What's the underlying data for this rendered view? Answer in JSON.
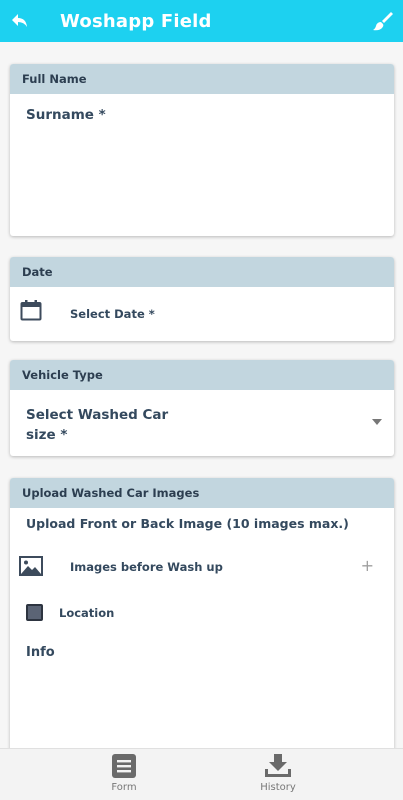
{
  "appbar": {
    "title": "Woshapp Field",
    "back_icon": "back-arrow-icon",
    "action_icon": "paint-brush-icon",
    "color": "#1dd1f0"
  },
  "full_name": {
    "header": "Full Name",
    "surname_label": "Surname *"
  },
  "date": {
    "header": "Date",
    "icon": "calendar-icon",
    "select_label": "Select Date *"
  },
  "vehicle": {
    "header": "Vehicle Type",
    "select_label": "Select Washed Car size *",
    "icon": "dropdown-caret-icon"
  },
  "upload": {
    "header": "Upload Washed Car Images",
    "subtitle": "Upload Front or Back Image (10 images max.)",
    "images_label": "Images before Wash up",
    "images_icon": "image-icon",
    "add_symbol": "+",
    "location_label": "Location",
    "info_label": "Info"
  },
  "nav": {
    "items": [
      {
        "label": "Form",
        "icon": "form-icon"
      },
      {
        "label": "History",
        "icon": "download-icon"
      }
    ]
  },
  "colors": {
    "header_band": "#c2d6df",
    "text": "#34495e"
  }
}
